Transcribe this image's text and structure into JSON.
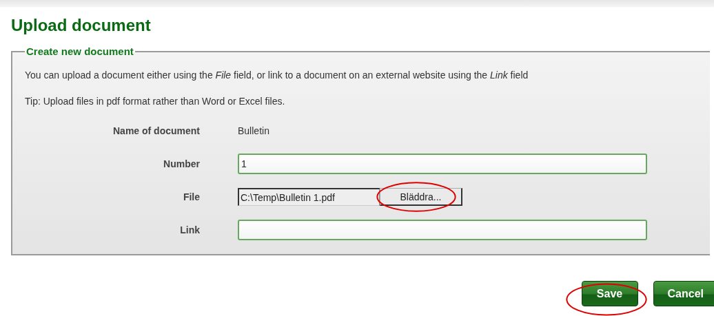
{
  "title": "Upload document",
  "form": {
    "legend": "Create new document",
    "intro": "You can upload a document either using the *File* field, or link to a document on an external website using the *Link* field",
    "tip": "Tip: Upload files in pdf format rather than Word or Excel files.",
    "fields": [
      {
        "kind": "static",
        "label": "Name of document",
        "value": "Bulletin"
      },
      {
        "kind": "text",
        "label": "Number",
        "value": "1"
      },
      {
        "kind": "file",
        "label": "File",
        "value": "C:\\Temp\\Bulletin 1.pdf",
        "button": "Bläddra...",
        "highlighted": true
      },
      {
        "kind": "text",
        "label": "Link"
      }
    ]
  },
  "buttons": [
    {
      "label": "Save",
      "highlighted": true
    },
    {
      "label": "Cancel",
      "highlighted": false
    }
  ]
}
